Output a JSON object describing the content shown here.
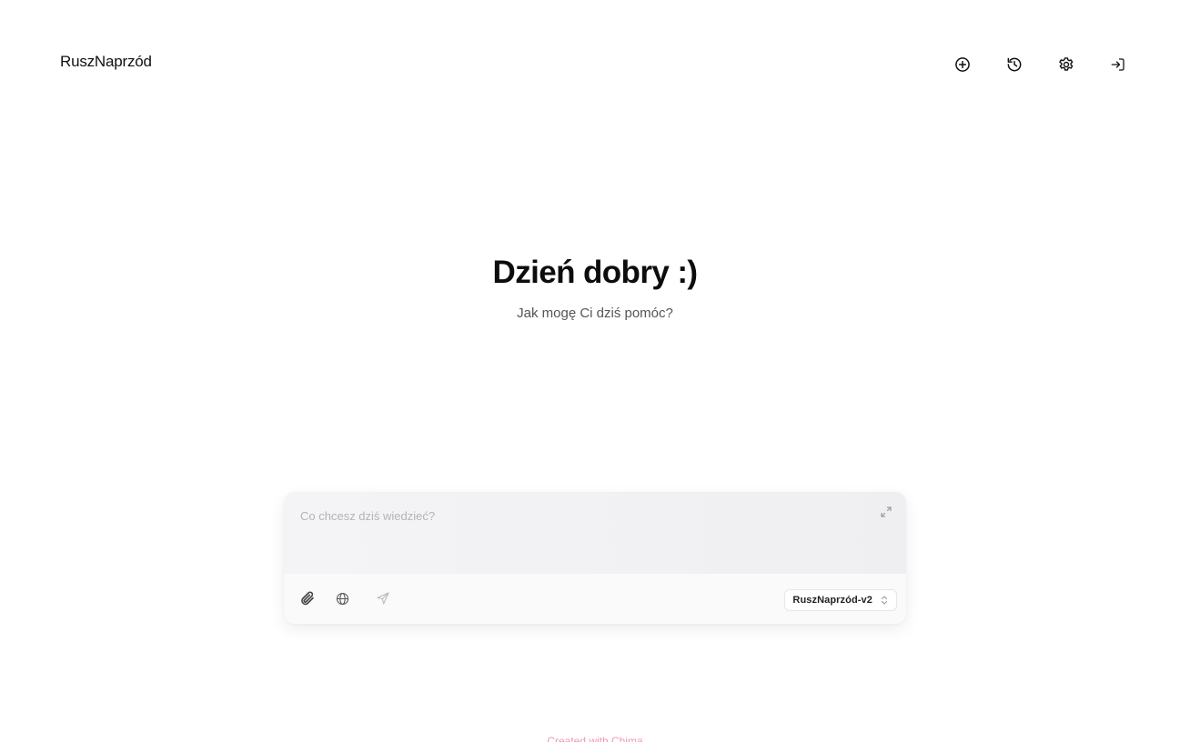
{
  "header": {
    "brand": "RuszNaprzód",
    "actions": [
      {
        "name": "new-chat",
        "icon": "plus-circle-icon"
      },
      {
        "name": "history",
        "icon": "history-icon"
      },
      {
        "name": "settings",
        "icon": "gear-icon"
      },
      {
        "name": "login",
        "icon": "login-icon"
      }
    ]
  },
  "hero": {
    "title": "Dzień dobry :)",
    "subtitle": "Jak mogę Ci dziś pomóc?"
  },
  "composer": {
    "placeholder": "Co chcesz dziś wiedzieć?",
    "value": "",
    "model": "RuszNaprzód-v2",
    "tools": [
      "paperclip-icon",
      "globe-icon",
      "send-icon"
    ]
  },
  "footer": {
    "text": "Created with Chima"
  },
  "colors": {
    "background": "#ffffff",
    "text": "#111111",
    "muted": "#555555",
    "placeholder": "#b3b3b8",
    "composer_bg": "#f4f4f6",
    "footer_accent": "#e0708a"
  }
}
